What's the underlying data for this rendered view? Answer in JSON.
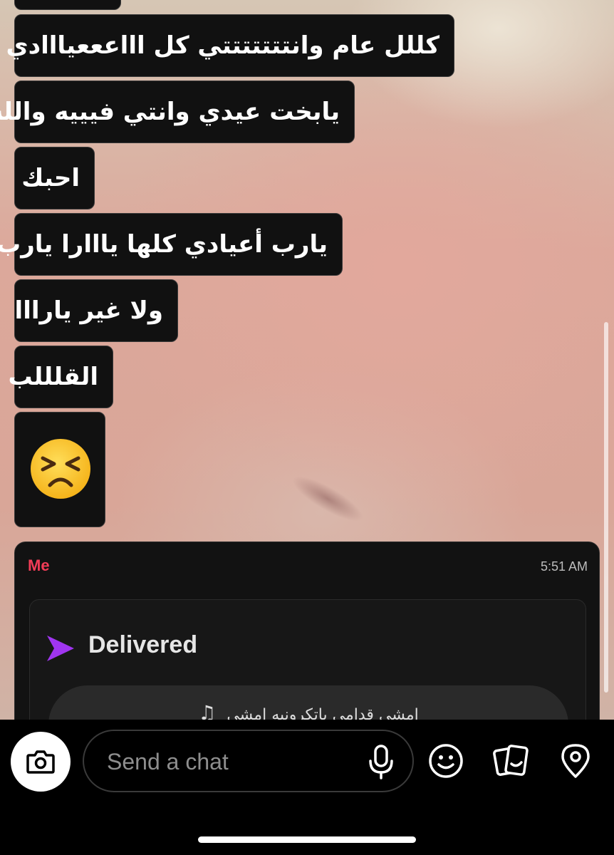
{
  "messages": [
    {
      "text": "كللل عام وانتتتتتتتي كل اااعععيااادي"
    },
    {
      "text": "يابخت عيدي وانتي فيييه والله"
    },
    {
      "text": "احبك"
    },
    {
      "text": "يارب أعيادي كلها يااارا يارب"
    },
    {
      "text": "ولا غير يارااا"
    },
    {
      "text": "القلللب"
    },
    {
      "emoji": "persevering-face"
    }
  ],
  "snap_card": {
    "sender": "Me",
    "time": "5:51 AM",
    "status": "Delivered",
    "status_color": "#a035f0",
    "song_title": "امشي قدامي ياتكرونيه امشي"
  },
  "composer": {
    "placeholder": "Send a chat",
    "icons": [
      "camera-icon",
      "microphone-icon",
      "emoji-icon",
      "stickers-icon",
      "location-icon"
    ]
  },
  "colors": {
    "sender_name": "#f23c57",
    "bubble_bg": "#111111"
  }
}
